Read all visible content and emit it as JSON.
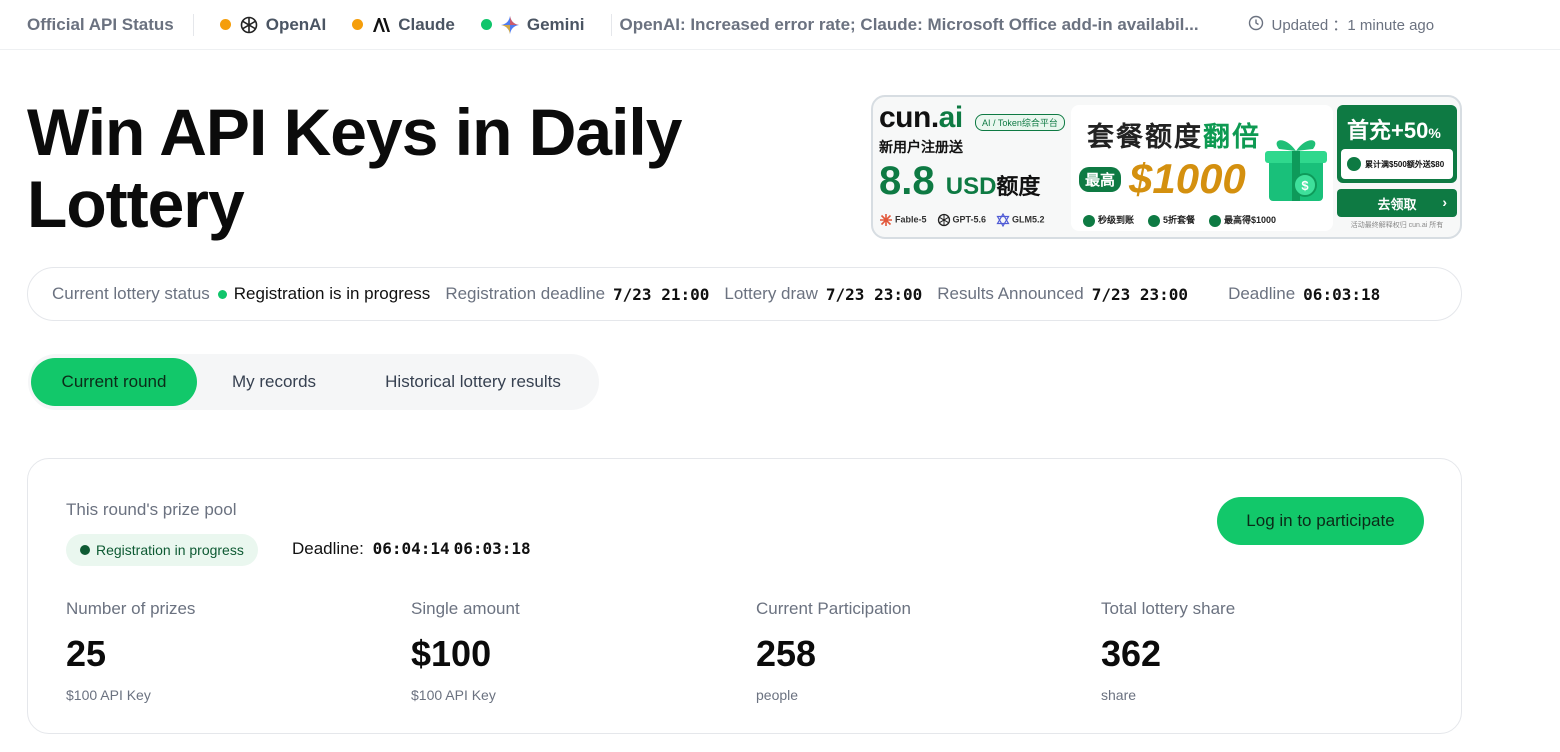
{
  "status_bar": {
    "title": "Official API Status",
    "providers": [
      {
        "name": "OpenAI",
        "status_color": "#f59e0b",
        "icon": "openai-icon"
      },
      {
        "name": "Claude",
        "status_color": "#f59e0b",
        "icon": "anthropic-icon"
      },
      {
        "name": "Gemini",
        "status_color": "#10c56b",
        "icon": "gemini-icon"
      }
    ],
    "incident": "OpenAI: Increased error rate; Claude: Microsoft Office add-in availabil...",
    "updated_label": "Updated ：1 minute ago"
  },
  "hero": {
    "title": "Win API Keys in Daily Lottery"
  },
  "ad": {
    "brand_prefix": "cun.",
    "brand_suffix": "ai",
    "tag": "AI / Token综合平台",
    "subtitle": "新用户注册送",
    "usd_amount": "8.8",
    "usd_unit": "USD",
    "usd_suffix": "额度",
    "models": [
      "Fable-5",
      "GPT-5.6",
      "GLM5.2"
    ],
    "headline_a": "套餐额度",
    "headline_b": "翻倍",
    "max_label": "最高",
    "max_amount": "$1000",
    "features": [
      "秒级到账",
      "5折套餐",
      "最高得$1000"
    ],
    "first_charge": "首充+50",
    "first_charge_pct": "%",
    "bonus_note": "累计满$500额外送$80",
    "claim_label": "去领取",
    "footnote": "活动最终解释权归 cun.ai 所有"
  },
  "lottery_status": {
    "label": "Current lottery status",
    "value": "Registration is in progress",
    "reg_deadline_label": "Registration deadline",
    "reg_deadline": "7/23 21:00",
    "draw_label": "Lottery draw",
    "draw_time": "7/23 23:00",
    "results_label": "Results Announced",
    "results_time": "7/23 23:00",
    "deadline_label": "Deadline",
    "deadline_countdown": "06:03:18"
  },
  "tabs": [
    {
      "label": "Current round",
      "active": true
    },
    {
      "label": "My records",
      "active": false
    },
    {
      "label": "Historical lottery results",
      "active": false
    }
  ],
  "prize_card": {
    "pool_label": "This round's prize pool",
    "badge": "Registration in progress",
    "deadline_label": "Deadline:",
    "deadline_a": "06:04:14",
    "deadline_b": "06:03:18",
    "login_button": "Log in to participate",
    "stats": [
      {
        "label": "Number of prizes",
        "value": "25",
        "unit": "$100 API Key"
      },
      {
        "label": "Single amount",
        "value": "$100",
        "unit": "$100 API Key"
      },
      {
        "label": "Current Participation",
        "value": "258",
        "unit": "people"
      },
      {
        "label": "Total lottery share",
        "value": "362",
        "unit": "share"
      }
    ]
  },
  "colors": {
    "accent_green": "#12c86a",
    "status_orange": "#f59e0b",
    "status_green": "#10c56b",
    "brand_dark_green": "#0e7a43"
  }
}
